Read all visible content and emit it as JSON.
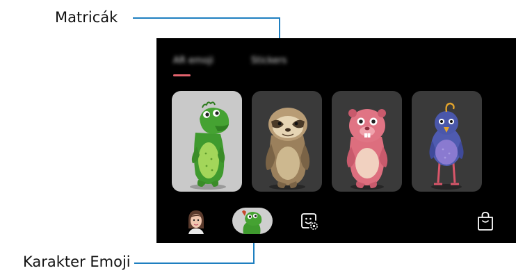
{
  "callouts": {
    "stickers_label": "Matricák",
    "character_emoji_label": "Karakter Emoji"
  },
  "tabs": [
    {
      "label": "AR emoji",
      "selected": true
    },
    {
      "label": "Stickers",
      "selected": false
    }
  ],
  "characters": [
    {
      "name": "green-dinosaur",
      "selected": true
    },
    {
      "name": "sloth",
      "selected": false
    },
    {
      "name": "pink-beaver",
      "selected": false
    },
    {
      "name": "blue-bird",
      "selected": false
    }
  ],
  "bottom_bar": {
    "items": [
      "my-emoji-avatar",
      "character-emoji",
      "sticker-settings",
      "store"
    ]
  },
  "colors": {
    "accent": "#e2636d",
    "callout_line": "#1e7fc0",
    "screen_background": "#000000"
  }
}
